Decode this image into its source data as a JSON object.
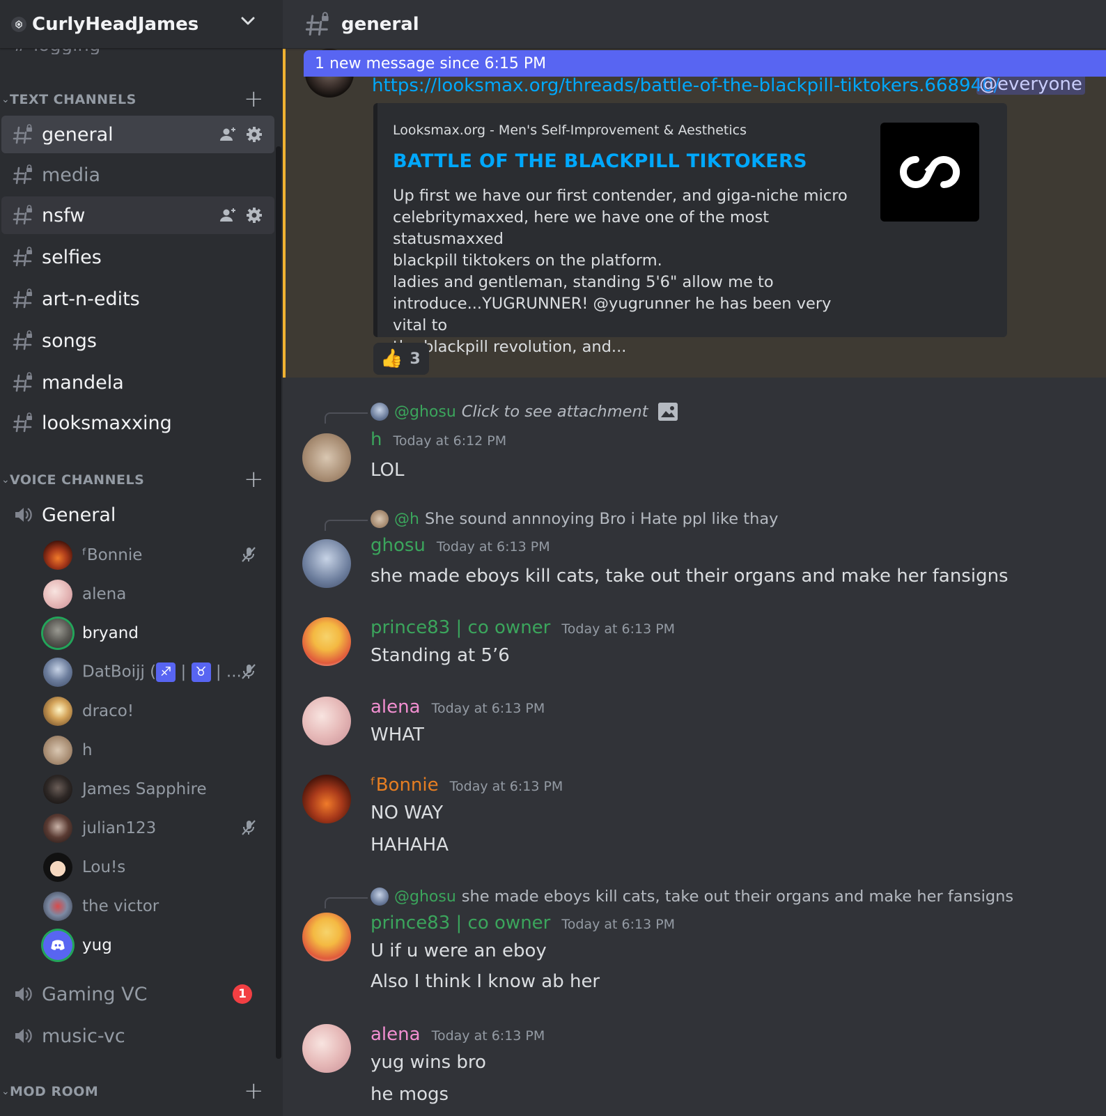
{
  "server": {
    "name": "CurlyHeadJames"
  },
  "sidebar": {
    "partial_channel": "logging",
    "text_category": "TEXT CHANNELS",
    "voice_category": "VOICE CHANNELS",
    "mod_category": "MOD ROOM",
    "text_channels": [
      {
        "name": "general"
      },
      {
        "name": "media"
      },
      {
        "name": "nsfw"
      },
      {
        "name": "selfies"
      },
      {
        "name": "art-n-edits"
      },
      {
        "name": "songs"
      },
      {
        "name": "mandela"
      },
      {
        "name": "looksmaxxing"
      }
    ],
    "voice_channels": [
      {
        "name": "General"
      },
      {
        "name": "Gaming VC",
        "badge": "1"
      },
      {
        "name": "music-vc"
      }
    ],
    "voice_users": [
      {
        "name": "ᶠBonnie"
      },
      {
        "name": "alena"
      },
      {
        "name": "bryand"
      },
      {
        "name": "DatBoijj (",
        "tag1": "♐",
        "sep": " | ",
        "tag2": "♉",
        "rest": " | ..."
      },
      {
        "name": "draco!"
      },
      {
        "name": "h"
      },
      {
        "name": "James Sapphire"
      },
      {
        "name": "julian123"
      },
      {
        "name": "Lou!s"
      },
      {
        "name": "the victor"
      },
      {
        "name": "yug"
      }
    ]
  },
  "channel": {
    "title": "general"
  },
  "new_messages_bar": "1 new message since 6:15 PM",
  "pinned_message": {
    "link": "https://looksmax.org/threads/battle-of-the-blackpill-tiktokers.668940/",
    "mention": "@everyone",
    "embed": {
      "provider": "Looksmax.org - Men's Self-Improvement & Aesthetics",
      "title": "BATTLE OF THE BLACKPILL TIKTOKERS",
      "description_lines": [
        "Up first we have our first contender, and giga-niche micro",
        "celebritymaxxed, here we have one of the most statusmaxxed",
        "blackpill tiktokers on the platform.",
        "ladies and gentleman, standing 5'6\" allow me to",
        "introduce...YUGRUNNER! @yugrunner he has been very vital to",
        "the blackpill revolution, and..."
      ]
    },
    "reaction": {
      "emoji": "👍",
      "count": "3"
    }
  },
  "messages": [
    {
      "reply": {
        "name": "@ghosu",
        "text": "Click to see attachment"
      },
      "author": "h",
      "time": "Today at 6:12 PM",
      "lines": [
        "LOL"
      ]
    },
    {
      "reply": {
        "name": "@h",
        "text": "She sound annnoying Bro i Hate ppl like thay"
      },
      "author": "ghosu",
      "time": "Today at 6:13 PM",
      "lines": [
        "she made eboys kill cats, take out their organs and make her fansigns"
      ]
    },
    {
      "author": "prince83 | co owner",
      "time": "Today at 6:13 PM",
      "lines": [
        "Standing at 5’6"
      ]
    },
    {
      "author": "alena",
      "time": "Today at 6:13 PM",
      "lines": [
        "WHAT"
      ]
    },
    {
      "author": "ᶠBonnie",
      "time": "Today at 6:13 PM",
      "lines": [
        "NO WAY",
        "HAHAHA"
      ]
    },
    {
      "reply": {
        "name": "@ghosu",
        "text": "she made eboys kill cats, take out their organs and make her fansigns"
      },
      "author": "prince83 | co owner",
      "time": "Today at 6:13 PM",
      "lines": [
        "U if u were an eboy",
        "Also I think I know ab her"
      ]
    },
    {
      "author": "alena",
      "time": "Today at 6:13 PM",
      "lines": [
        "yug wins bro",
        "he mogs"
      ]
    }
  ],
  "colors": {
    "accent": "#5865f2",
    "mention_highlight": "#f0b232",
    "link": "#00a8fc",
    "role_green": "#3ba55c",
    "role_pink": "#f28fd1",
    "role_orange": "#e67e22",
    "unread_badge": "#f23f43"
  },
  "icons": {
    "server_boost": "boost-icon",
    "server_menu": "chevron-down-icon",
    "text_channel": "hashtag-lock-icon",
    "voice_channel": "speaker-icon",
    "invite": "add-user-icon",
    "settings": "gear-icon",
    "muted": "mic-muted-icon",
    "add": "plus-icon",
    "attachment": "image-icon"
  }
}
